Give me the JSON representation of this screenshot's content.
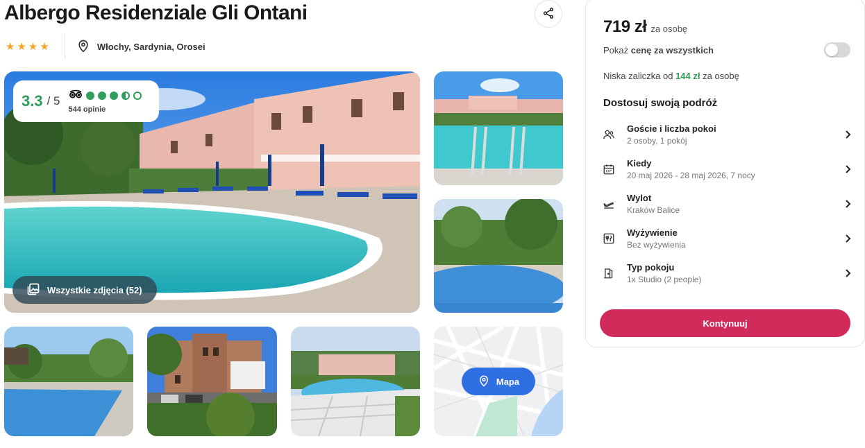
{
  "hotel": {
    "name": "Albergo Residenziale Gli Ontani",
    "stars": 4,
    "location": "Włochy, Sardynia, Orosei"
  },
  "icons": {
    "share": "share-icon",
    "location": "map-pin-icon",
    "tripadvisor": "tripadvisor-owl-icon",
    "gallery": "gallery-icon",
    "map": "map-pin-icon",
    "chevron": "chevron-right-icon"
  },
  "rating": {
    "score": "3.3",
    "max": "/ 5",
    "bubbles": 3.5,
    "reviews": "544 opinie"
  },
  "gallery": {
    "all_photos_label": "Wszystkie zdjęcia (52)",
    "map_label": "Mapa"
  },
  "panel": {
    "price": "719 zł",
    "per_person": "za osobę",
    "toggle_prefix": "Pokaż",
    "toggle_bold": "cenę za wszystkich",
    "toggle_on": false,
    "deposit_prefix": "Niska zaliczka od",
    "deposit_amount": "144 zł",
    "deposit_suffix": "za osobę",
    "customize_title": "Dostosuj swoją podróż",
    "options": [
      {
        "label": "Goście i liczba pokoi",
        "value": "2 osoby, 1 pokój",
        "icon": "users-icon"
      },
      {
        "label": "Kiedy",
        "value": "20 maj 2026 - 28 maj 2026, 7 nocy",
        "icon": "calendar-icon"
      },
      {
        "label": "Wylot",
        "value": "Kraków Balice",
        "icon": "plane-takeoff-icon"
      },
      {
        "label": "Wyżywienie",
        "value": "Bez wyżywienia",
        "icon": "meal-icon"
      },
      {
        "label": "Typ pokoju",
        "value": "1x Studio (2 people)",
        "icon": "door-icon"
      }
    ],
    "cta_label": "Kontynuuj"
  },
  "colors": {
    "star": "#f5a524",
    "rating_green": "#2f9e5a",
    "cta": "#d12b5c",
    "map_button": "#2f6fe3"
  }
}
